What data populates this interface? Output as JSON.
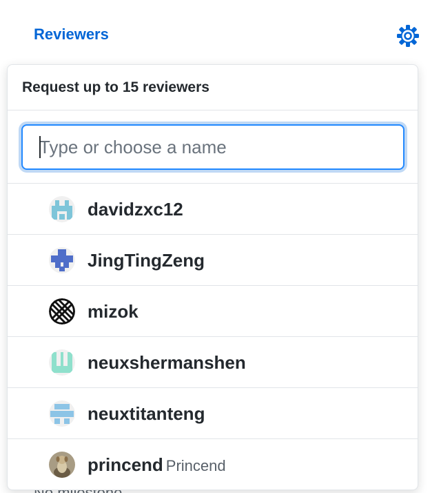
{
  "sidebar": {
    "title": "Reviewers",
    "settings_icon": "gear-icon",
    "next_section_text": "No milestone"
  },
  "popover": {
    "header": "Request up to 15 reviewers",
    "filter": {
      "placeholder": "Type or choose a name",
      "value": ""
    },
    "items": [
      {
        "login": "davidzxc12",
        "name": "",
        "avatar": "identicon-teal"
      },
      {
        "login": "JingTingZeng",
        "name": "",
        "avatar": "identicon-blue"
      },
      {
        "login": "mizok",
        "name": "",
        "avatar": "pattern-black"
      },
      {
        "login": "neuxshermanshen",
        "name": "",
        "avatar": "identicon-mint"
      },
      {
        "login": "neuxtitanteng",
        "name": "",
        "avatar": "identicon-lightblue"
      },
      {
        "login": "princend",
        "name": "Princend",
        "avatar": "photo-dog"
      }
    ]
  },
  "colors": {
    "accent": "#0366d6",
    "border": "#e1e4e8",
    "text": "#24292e",
    "muted": "#586069"
  }
}
